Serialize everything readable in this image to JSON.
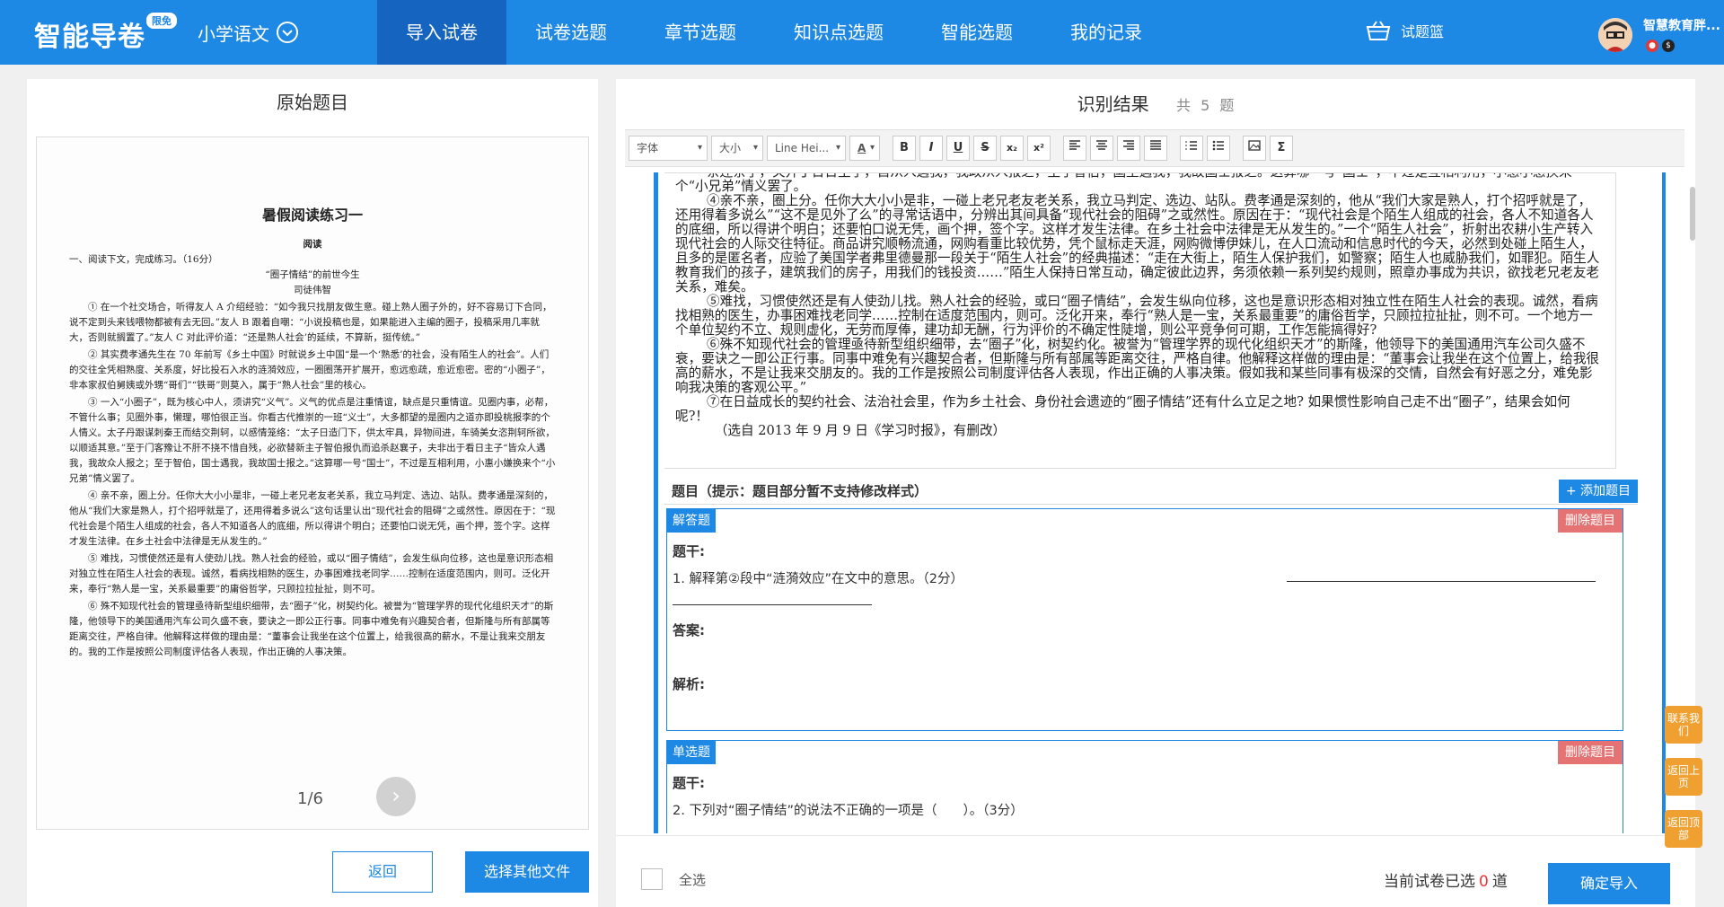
{
  "header": {
    "logo": "智能导卷",
    "logo_badge": "限免",
    "subject": "小学语文",
    "nav": [
      "导入试卷",
      "试卷选题",
      "章节选题",
      "知识点选题",
      "智能选题",
      "我的记录"
    ],
    "active_nav": "导入试卷",
    "basket": "试题篮",
    "username": "智慧教育胖...",
    "brand_color": "#1e88e5"
  },
  "left": {
    "title": "原始题目",
    "doc": {
      "title": "暑假阅读练习一",
      "section": "阅读",
      "instruction": "一、阅读下文，完成练习。（16分）",
      "article_title": "“圈子情结”的前世今生",
      "author": "司徒伟智",
      "paragraphs": [
        "① 在一个社交场合，听得友人 A 介绍经验：“如今我只找朋友做生意。碰上熟人圈子外的，好不容易订下合同，说不定到头来钱喂物都被有去无回。”友人 B 跟着自嘲：“小说投稿也是，如果能进入主编的圈子，投稿采用几率就大，否则就搁置了。”友人 C 对此评价道：“还是熟人社会’的延续，不算新，挺传统。”",
        "② 其实费孝通先生在 70 年前写《乡土中国》时就说乡土中国“是一个‘熟悉’的社会，没有陌生人的社会”。人们的交往全凭相熟度、关系度，好比投石入水的涟漪效应，一圈圈荡开扩展开，愈远愈疏，愈近愈密。密的“小圈子”，非本家叔伯舅姨或外甥“哥们”“铁哥”则莫入，属于“熟人社会”里的核心。",
        "③ 一入“小圈子”，既为核心中人，须讲究“义气”。义气的优点是注重情谊，缺点是只重情谊。见圈内事，必帮，不管什么事；见圈外事，懒理，哪怕很正当。你看古代推崇的一班“义士”，大多都望的是圈内之道亦即投桃报李的个人情义。太子丹跟谋刺秦王而结交荆轲，以感情笼络：“太子日造门下，供太牢具，异物间进，车骑美女恣荆轲所欲，以顺适其意。”至于门客豫让不肝不挠不惜自残，必欲替新主子智伯报仇而追杀赵襄子，夫非出于看日主子“皆众人遇我，我故众人报之；至于智伯，国士遇我，我故国士报之。”这算哪一号“国士”，不过是互相利用，小惠小嫌换来个“小兄弟”情义罢了。",
        "④ 亲不亲，圈上分。任你大大小小是非，一碰上老兄老友老关系，我立马判定、选边、站队。费孝通是深刻的，他从“我们大家是熟人，打个招呼就是了，还用得着多说么”这句话里认出“现代社会的阻碍”之或然性。原因在于：“现代社会是个陌生人组成的社会，各人不知道各人的底细，所以得讲个明白；还要怕口说无凭，画个押，签个字。这样才发生法律。在乡土社会中法律是无从发生的。”",
        "⑤ 难找，习惯使然还是有人使劲儿找。熟人社会的经验，或以“圈子情结”，会发生纵向位移，这也是意识形态相对独立性在陌生人社会的表现。诚然，看病找相熟的医生，办事困难找老同学……控制在适度范围内，则可。泛化开来，奉行“熟人是一宝，关系最重要”的庸俗哲学，只顾拉拉扯扯，则不可。",
        "⑥ 殊不知现代社会的管理亟待新型组织细带，去“圈子”化，树契约化。被誉为“管理学界的现代化组织天才”的斯隆，他领导下的美国通用汽车公司久盛不衰，要诀之一即公正行事。同事中难免有兴趣契合者，但斯隆与所有部属等距离交往，严格自律。他解释这样做的理由是：“董事会让我坐在这个位置上，给我很高的薪水，不是让我来交朋友的。我的工作是按照公司制度评估各人表现，作出正确的人事决策。"
      ],
      "page_indicator": "1/6"
    },
    "back_button": "返回",
    "choose_button": "选择其他文件"
  },
  "right": {
    "title": "识别结果",
    "count_prefix": "共",
    "count": "5",
    "count_suffix": "题",
    "toolbar": {
      "font": "字体",
      "size": "大小",
      "line_height": "Line Hei...",
      "font_color": "A",
      "bold": "B",
      "italic": "I",
      "underline": "U",
      "strike": "S",
      "subscript": "x₂",
      "superscript": "x²",
      "formula": "Σ"
    },
    "article_lines": [
      "亲还亲了，关开丁日日主于，自从入遇我，我政从入报之，主于智伯，国土遇我，我故国士报之。”这算哪一号“国士”，不过是互相利用，小惠小惠换来个“小兄弟”情义罢了。",
      "④亲不亲，圈上分。任你大大小小是非，一碰上老兄老友老关系，我立马判定、选边、站队。费孝通是深刻的，他从“我们大家是熟人，打个招呼就是了，还用得着多说么”“这不是见外了么”的寻常话语中，分辨出其间具备“现代社会的阻碍”之或然性。原因在于：“现代社会是个陌生人组成的社会，各人不知道各人的底细，所以得讲个明白；还要怕口说无凭，画个押，签个字。这样才发生法律。在乡土社会中法律是无从发生的。”一个“陌生人社会”，折射出农耕小生产转入现代社会的人际交往特征。商品讲究顺畅流通，网购看重比较优势，凭个鼠标走天涯，网购微博伊妹儿，在人口流动和信息时代的今天，必然到处碰上陌生人，且多的是匿名者，应验了美国学者弗里德曼那一段关于“陌生人社会”的经典描述：“走在大街上，陌生人保护我们，如警察；陌生人也威胁我们，如罪犯。陌生人教育我们的孩子，建筑我们的房子，用我们的钱投资……”陌生人保持日常互动，确定彼此边界，务须依赖一系列契约规则，照章办事成为共识，欲找老兄老友老关系，难矣。",
      "⑤难找，习惯使然还是有人使劲儿找。熟人社会的经验，或曰“圈子情结”，会发生纵向位移，这也是意识形态相对独立性在陌生人社会的表现。诚然，看病找相熟的医生，办事困难找老同学……控制在适度范围内，则可。泛化开来，奉行“熟人是一宝，关系最重要”的庸俗哲学，只顾拉拉扯扯，则不可。一个地方一个单位契约不立、规则虚化，无劳而厚俸，建功却无酬，行为评价的不确定性陡增，则公平竞争何可期，工作怎能搞得好?",
      "⑥殊不知现代社会的管理亟待新型组织细带，去“圈子”化，树契约化。被誉为“管理学界的现代化组织天才”的斯隆，他领导下的美国通用汽车公司久盛不衰，要诀之一即公正行事。同事中难免有兴趣契合者，但斯隆与所有部属等距离交往，严格自律。他解释这样做的理由是：“董事会让我坐在这个位置上，给我很高的薪水，不是让我来交朋友的。我的工作是按照公司制度评估各人表现，作出正确的人事决策。假如我和某些同事有极深的交情，自然会有好恶之分，难免影响我决策的客观公平。”",
      "⑦在日益成长的契约社会、法治社会里，作为乡土社会、身份社会遗迹的“圈子情结”还有什么立足之地? 如果惯性影响自己走不出“圈子”，结果会如何呢?！"
    ],
    "article_source": "（选自 2013 年 9 月 9 日《学习时报》，有删改）",
    "questions_header": "题目（提示：题目部分暂不支持修改样式）",
    "add_button": "+ 添加题目",
    "questions": [
      {
        "type": "解答题",
        "delete": "删除题目",
        "stem_label": "题干:",
        "stem": "1. 解释第②段中“涟漪效应”在文中的意思。（2分）",
        "answer_label": "答案:",
        "analysis_label": "解析:"
      },
      {
        "type": "单选题",
        "delete": "删除题目",
        "stem_label": "题干:",
        "stem": "2. 下列对“圈子情结”的说法不正确的一项是（　　）。（3分）"
      }
    ],
    "footer": {
      "select_all": "全选",
      "selected_prefix": "当前试卷已选",
      "selected_count": "0",
      "selected_suffix": "道",
      "confirm": "确定导入"
    }
  },
  "float_buttons": [
    "联系我们",
    "返回上页",
    "返回顶部"
  ]
}
